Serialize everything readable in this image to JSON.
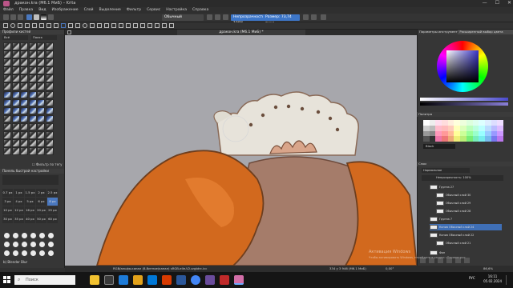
{
  "window": {
    "title": "дракон.kra (M6.1 МиБ) – Krita",
    "buttons": [
      "—",
      "☐",
      "✕"
    ]
  },
  "menu": [
    "Файл",
    "Правка",
    "Вид",
    "Изображение",
    "Слой",
    "Выделение",
    "Фильтр",
    "Сервис",
    "Настройка",
    "Справка"
  ],
  "toolbar": {
    "blend_mode": "Обычный",
    "opacity_label": "Непрозрачность: 100%",
    "size_label": "Размер: 73,74 пикс."
  },
  "left_panel": {
    "brush_presets_title": "Профили кистей",
    "tag_label": "Всё",
    "search_label": "Поиск",
    "filter_label": "Фильтр по тегу",
    "quick_settings_title": "Панель быстрой настройки",
    "sizes": [
      "0.7 px",
      "1 px",
      "1.5 px",
      "2 px",
      "2.5 px",
      "3 px",
      "4 px",
      "5 px",
      "6 px",
      "8 px",
      "10 px",
      "12 px",
      "16 px",
      "20 px",
      "25 px",
      "30 px",
      "35 px",
      "40 px",
      "50 px",
      "60 px"
    ],
    "selected_size": "8 px",
    "preset_name": "b) Blender Blur"
  },
  "canvas": {
    "tab_title": "дракон.kra (M6.1 МиБ) *"
  },
  "status": {
    "left": "RGB/альфа-канал (8-битное/канал) sRGB-elle-V2-srgbtrc.icc",
    "size": "334 у 3 946 (M6.1 МиБ)",
    "rotation": "0,00°",
    "zoom": "86,6%"
  },
  "right_panel": {
    "tab_tool_options": "Параметры инструмента",
    "tab_color": "Расширенный выбор цвета",
    "palette_title": "Палитра",
    "palette_name": "Black",
    "layers_title": "Слои",
    "blend_label": "Нормальное",
    "opacity": "Непрозрачность: 100%",
    "layers": [
      {
        "name": "Группа 27"
      },
      {
        "name": "Обычный слой 30"
      },
      {
        "name": "Обычный слой 29"
      },
      {
        "name": "Обычный слой 28"
      },
      {
        "name": "Группа 7"
      },
      {
        "name": "Копия Обычный слой 24"
      },
      {
        "name": "Копия Обычный слой 22"
      },
      {
        "name": "Обычный слой 21"
      },
      {
        "name": "Фон"
      }
    ],
    "selected_layer": 5
  },
  "watermark": {
    "line1": "Активация Windows",
    "line2": "Чтобы активировать Windows, перейдите в раздел «Параметры»"
  },
  "taskbar": {
    "search_placeholder": "Поиск",
    "time": "16:11",
    "date": "05.02.2024",
    "lang": "РУС"
  },
  "colors": {
    "accent": "#3d76c8",
    "canvas_grey": "#a7a7ac",
    "orange": "#d2691e",
    "brown": "#8a6a57"
  }
}
